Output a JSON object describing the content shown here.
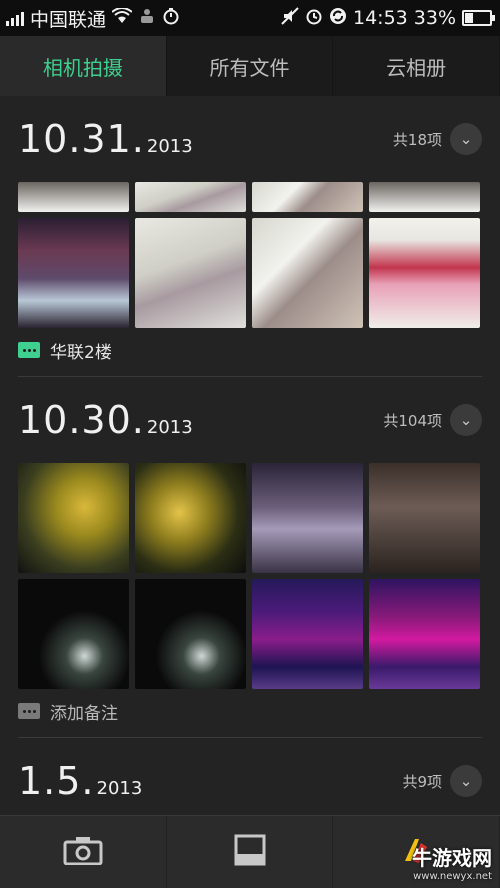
{
  "status_bar": {
    "carrier": "中国联通",
    "time": "14:53",
    "battery_percent": "33%",
    "battery_level": 0.33,
    "icons": [
      "signal-icon",
      "wifi-icon",
      "usb-debug-icon",
      "timer-icon",
      "mute-icon",
      "alarm-icon",
      "sync-icon",
      "battery-icon"
    ]
  },
  "tabs": [
    {
      "label": "相机拍摄",
      "active": true
    },
    {
      "label": "所有文件",
      "active": false
    },
    {
      "label": "云相册",
      "active": false
    }
  ],
  "sections": [
    {
      "date": "10.31.",
      "year": "2013",
      "count": "共18项",
      "note": "华联2楼",
      "note_color": "#3fcf8e"
    },
    {
      "date": "10.30.",
      "year": "2013",
      "count": "共104项",
      "note": "添加备注",
      "note_color": "#7a7a7a"
    },
    {
      "date": "1.5.",
      "year": "2013",
      "count": "共9项"
    }
  ],
  "bottom_bar": {
    "icons": [
      "camera-icon",
      "album-icon",
      "app-icon"
    ]
  },
  "watermark": {
    "brand": "牛游戏网",
    "url": "www.newyx.net"
  },
  "colors": {
    "accent": "#3fcf8e",
    "background": "#232323"
  }
}
